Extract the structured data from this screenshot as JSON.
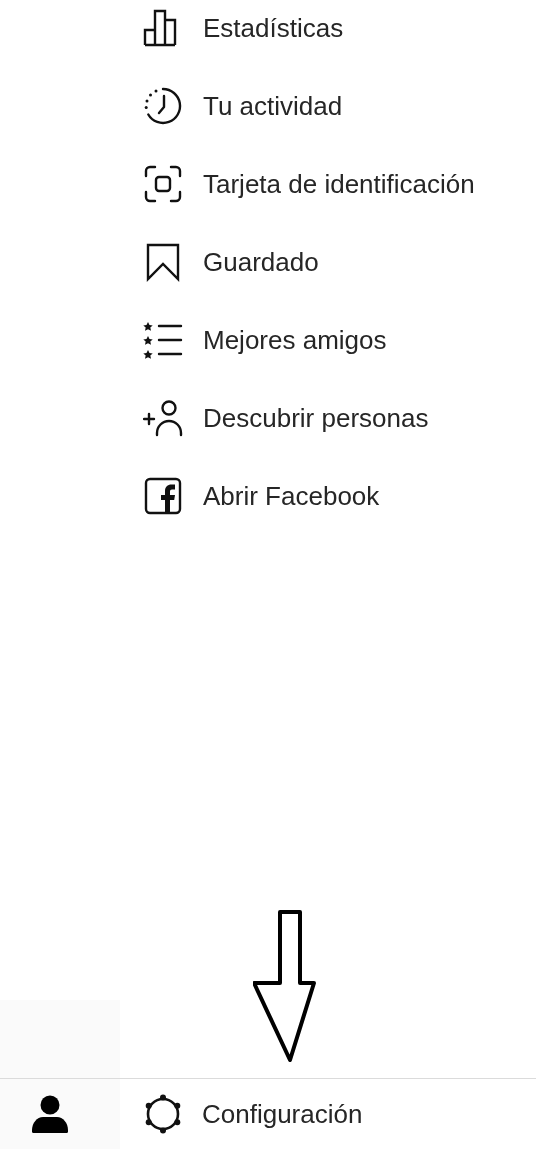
{
  "menu": {
    "items": [
      {
        "label": "Estadísticas"
      },
      {
        "label": "Tu actividad"
      },
      {
        "label": "Tarjeta de identificación"
      },
      {
        "label": "Guardado"
      },
      {
        "label": "Mejores amigos"
      },
      {
        "label": "Descubrir personas"
      },
      {
        "label": "Abrir Facebook"
      }
    ]
  },
  "bottom_bar": {
    "settings": {
      "label": "Configuración"
    }
  }
}
